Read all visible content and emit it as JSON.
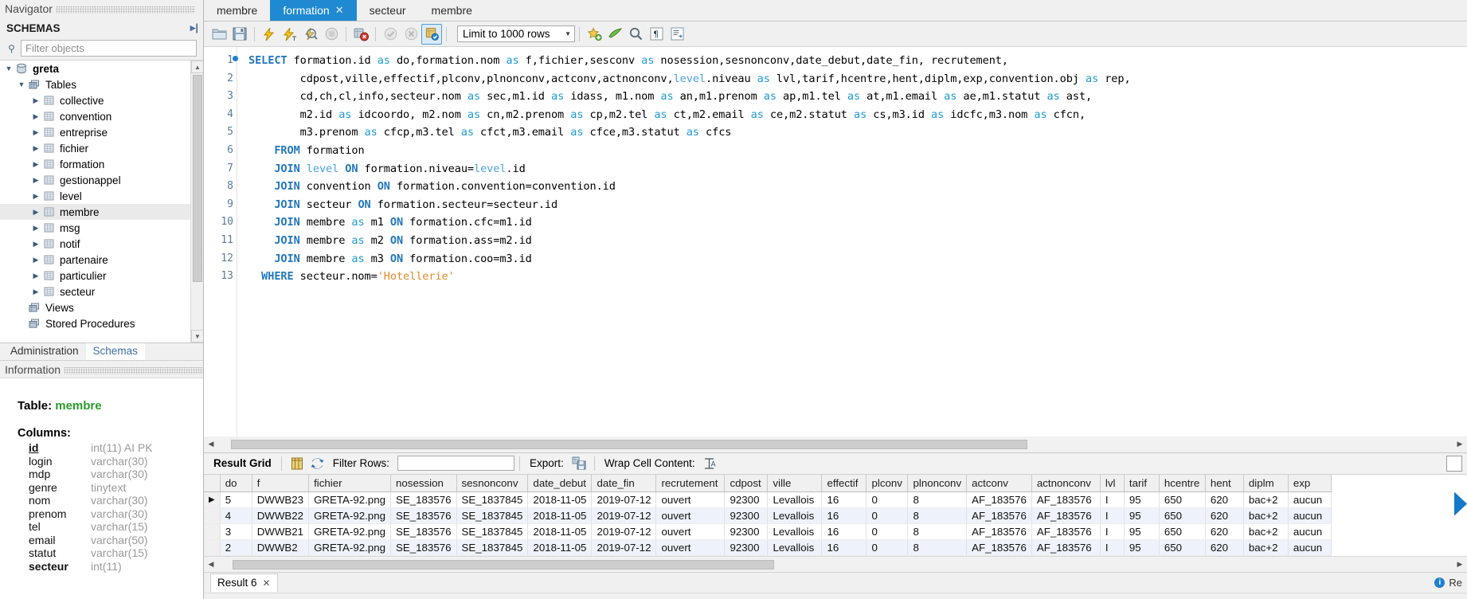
{
  "navigator": {
    "caption": "Navigator",
    "schemas_header": "SCHEMAS",
    "pin_icon": "pin-icon",
    "filter_placeholder": "Filter objects",
    "filter_value": "",
    "search_icon": "search-icon",
    "tree": [
      {
        "label": "greta",
        "level": 0,
        "icon": "database-icon",
        "expanded": true,
        "bold": true,
        "selected": false
      },
      {
        "label": "Tables",
        "level": 1,
        "icon": "folder-tables-icon",
        "expanded": true,
        "bold": false,
        "selected": false
      },
      {
        "label": "collective",
        "level": 2,
        "icon": "table-icon",
        "expanded": false,
        "bold": false,
        "selected": false
      },
      {
        "label": "convention",
        "level": 2,
        "icon": "table-icon",
        "expanded": false,
        "bold": false,
        "selected": false
      },
      {
        "label": "entreprise",
        "level": 2,
        "icon": "table-icon",
        "expanded": false,
        "bold": false,
        "selected": false
      },
      {
        "label": "fichier",
        "level": 2,
        "icon": "table-icon",
        "expanded": false,
        "bold": false,
        "selected": false
      },
      {
        "label": "formation",
        "level": 2,
        "icon": "table-icon",
        "expanded": false,
        "bold": false,
        "selected": false
      },
      {
        "label": "gestionappel",
        "level": 2,
        "icon": "table-icon",
        "expanded": false,
        "bold": false,
        "selected": false
      },
      {
        "label": "level",
        "level": 2,
        "icon": "table-icon",
        "expanded": false,
        "bold": false,
        "selected": false
      },
      {
        "label": "membre",
        "level": 2,
        "icon": "table-icon",
        "expanded": false,
        "bold": false,
        "selected": true
      },
      {
        "label": "msg",
        "level": 2,
        "icon": "table-icon",
        "expanded": false,
        "bold": false,
        "selected": false
      },
      {
        "label": "notif",
        "level": 2,
        "icon": "table-icon",
        "expanded": false,
        "bold": false,
        "selected": false
      },
      {
        "label": "partenaire",
        "level": 2,
        "icon": "table-icon",
        "expanded": false,
        "bold": false,
        "selected": false
      },
      {
        "label": "particulier",
        "level": 2,
        "icon": "table-icon",
        "expanded": false,
        "bold": false,
        "selected": false
      },
      {
        "label": "secteur",
        "level": 2,
        "icon": "table-icon",
        "expanded": false,
        "bold": false,
        "selected": false
      },
      {
        "label": "Views",
        "level": 1,
        "icon": "folder-views-icon",
        "expanded": false,
        "bold": false,
        "selected": false
      },
      {
        "label": "Stored Procedures",
        "level": 1,
        "icon": "folder-procs-icon",
        "expanded": false,
        "bold": false,
        "selected": false
      }
    ],
    "bottom_tabs": [
      {
        "label": "Administration",
        "active": false
      },
      {
        "label": "Schemas",
        "active": true
      }
    ]
  },
  "information": {
    "caption": "Information",
    "table_label": "Table:",
    "table_name": "membre",
    "columns_label": "Columns:",
    "columns": [
      {
        "name": "id",
        "type": "int(11) AI PK",
        "pk": true
      },
      {
        "name": "login",
        "type": "varchar(30)",
        "pk": false
      },
      {
        "name": "mdp",
        "type": "varchar(30)",
        "pk": false
      },
      {
        "name": "genre",
        "type": "tinytext",
        "pk": false
      },
      {
        "name": "nom",
        "type": "varchar(30)",
        "pk": false
      },
      {
        "name": "prenom",
        "type": "varchar(30)",
        "pk": false
      },
      {
        "name": "tel",
        "type": "varchar(15)",
        "pk": false
      },
      {
        "name": "email",
        "type": "varchar(50)",
        "pk": false
      },
      {
        "name": "statut",
        "type": "varchar(15)",
        "pk": false
      },
      {
        "name": "secteur",
        "type": "int(11)",
        "pk": false,
        "bold": true
      }
    ]
  },
  "editor_tabs": [
    {
      "label": "membre",
      "active": false,
      "closable": false
    },
    {
      "label": "formation",
      "active": true,
      "closable": true
    },
    {
      "label": "secteur",
      "active": false,
      "closable": false
    },
    {
      "label": "membre",
      "active": false,
      "closable": false
    }
  ],
  "sql_toolbar": {
    "icons": [
      "open-script-icon",
      "save-script-icon",
      "execute-icon",
      "execute-current-statement-icon",
      "explain-icon",
      "stop-icon",
      "toggle-stop-on-error-icon",
      "commit-icon",
      "rollback-icon",
      "autocommit-icon"
    ],
    "limit_label": "Limit to 1000 rows",
    "after_icons": [
      "beautify-icon",
      "find-icon",
      "search-icon",
      "formatting-icon",
      "snippets-icon"
    ]
  },
  "sql": {
    "lines": [
      {
        "n": "1",
        "breakpoint": true,
        "indent": 0
      },
      {
        "n": "2",
        "breakpoint": false,
        "indent": 0
      },
      {
        "n": "3",
        "breakpoint": false,
        "indent": 0
      },
      {
        "n": "4",
        "breakpoint": false,
        "indent": 0
      },
      {
        "n": "5",
        "breakpoint": false,
        "indent": 0
      },
      {
        "n": "6",
        "breakpoint": false,
        "indent": 0
      },
      {
        "n": "7",
        "breakpoint": false,
        "indent": 0
      },
      {
        "n": "8",
        "breakpoint": false,
        "indent": 0
      },
      {
        "n": "9",
        "breakpoint": false,
        "indent": 0
      },
      {
        "n": "10",
        "breakpoint": false,
        "indent": 0
      },
      {
        "n": "11",
        "breakpoint": false,
        "indent": 0
      },
      {
        "n": "12",
        "breakpoint": false,
        "indent": 0
      },
      {
        "n": "13",
        "breakpoint": false,
        "indent": 0
      }
    ],
    "text": [
      "SELECT formation.id as do,formation.nom as f,fichier,sesconv as nosession,sesnonconv,date_debut,date_fin, recrutement,",
      "        cdpost,ville,effectif,plconv,plnonconv,actconv,actnonconv,level.niveau as lvl,tarif,hcentre,hent,diplm,exp,convention.obj as rep,",
      "        cd,ch,cl,info,secteur.nom as sec,m1.id as idass, m1.nom as an,m1.prenom as ap,m1.tel as at,m1.email as ae,m1.statut as ast,",
      "        m2.id as idcoordo, m2.nom as cn,m2.prenom as cp,m2.tel as ct,m2.email as ce,m2.statut as cs,m3.id as idcfc,m3.nom as cfcn,",
      "        m3.prenom as cfcp,m3.tel as cfct,m3.email as cfce,m3.statut as cfcs",
      "    FROM formation",
      "    JOIN level ON formation.niveau=level.id",
      "    JOIN convention ON formation.convention=convention.id",
      "    JOIN secteur ON formation.secteur=secteur.id",
      "    JOIN membre as m1 ON formation.cfc=m1.id",
      "    JOIN membre as m2 ON formation.ass=m2.id",
      "    JOIN membre as m3 ON formation.coo=m3.id",
      "  WHERE secteur.nom='Hotellerie'"
    ]
  },
  "results_toolbar": {
    "result_grid_label": "Result Grid",
    "grid-view-icon": "grid-view-icon",
    "refresh-icon": "refresh-icon",
    "filter_rows_label": "Filter Rows:",
    "filter_rows_value": "",
    "export_label": "Export:",
    "export-icon": "export-icon",
    "wrap_label": "Wrap Cell Content:",
    "wrap-icon": "wrap-cell-icon",
    "panel-toggle-icon": "panel-toggle-icon"
  },
  "grid": {
    "columns": [
      "do",
      "f",
      "fichier",
      "nosession",
      "sesnonconv",
      "date_debut",
      "date_fin",
      "recrutement",
      "cdpost",
      "ville",
      "effectif",
      "plconv",
      "plnonconv",
      "actconv",
      "actnonconv",
      "lvl",
      "tarif",
      "hcentre",
      "hent",
      "diplm",
      "exp"
    ],
    "rows": [
      {
        "marker": "▶",
        "cells": [
          "5",
          "DWWB23",
          "GRETA-92.png",
          "SE_183576",
          "SE_1837845",
          "2018-11-05",
          "2019-07-12",
          "ouvert",
          "92300",
          "Levallois",
          "16",
          "0",
          "8",
          "AF_183576",
          "AF_183576",
          "I",
          "95",
          "650",
          "620",
          "bac+2",
          "aucun"
        ]
      },
      {
        "marker": "",
        "cells": [
          "4",
          "DWWB22",
          "GRETA-92.png",
          "SE_183576",
          "SE_1837845",
          "2018-11-05",
          "2019-07-12",
          "ouvert",
          "92300",
          "Levallois",
          "16",
          "0",
          "8",
          "AF_183576",
          "AF_183576",
          "I",
          "95",
          "650",
          "620",
          "bac+2",
          "aucun"
        ]
      },
      {
        "marker": "",
        "cells": [
          "3",
          "DWWB21",
          "GRETA-92.png",
          "SE_183576",
          "SE_1837845",
          "2018-11-05",
          "2019-07-12",
          "ouvert",
          "92300",
          "Levallois",
          "16",
          "0",
          "8",
          "AF_183576",
          "AF_183576",
          "I",
          "95",
          "650",
          "620",
          "bac+2",
          "aucun"
        ]
      },
      {
        "marker": "",
        "cells": [
          "2",
          "DWWB2",
          "GRETA-92.png",
          "SE_183576",
          "SE_1837845",
          "2018-11-05",
          "2019-07-12",
          "ouvert",
          "92300",
          "Levallois",
          "16",
          "0",
          "8",
          "AF_183576",
          "AF_183576",
          "I",
          "95",
          "650",
          "620",
          "bac+2",
          "aucun"
        ]
      }
    ]
  },
  "result_tabs": [
    {
      "label": "Result 6",
      "closable": true
    }
  ],
  "status": {
    "info_icon": "info-icon",
    "text": "Re"
  },
  "colors": {
    "accent": "#1f8ad2",
    "keyword": "#2277bb",
    "identifier": "#4aa3df",
    "string": "#e08b28",
    "table_name": "#2a9d2a",
    "grid_alt_row": "#eef3fb"
  }
}
